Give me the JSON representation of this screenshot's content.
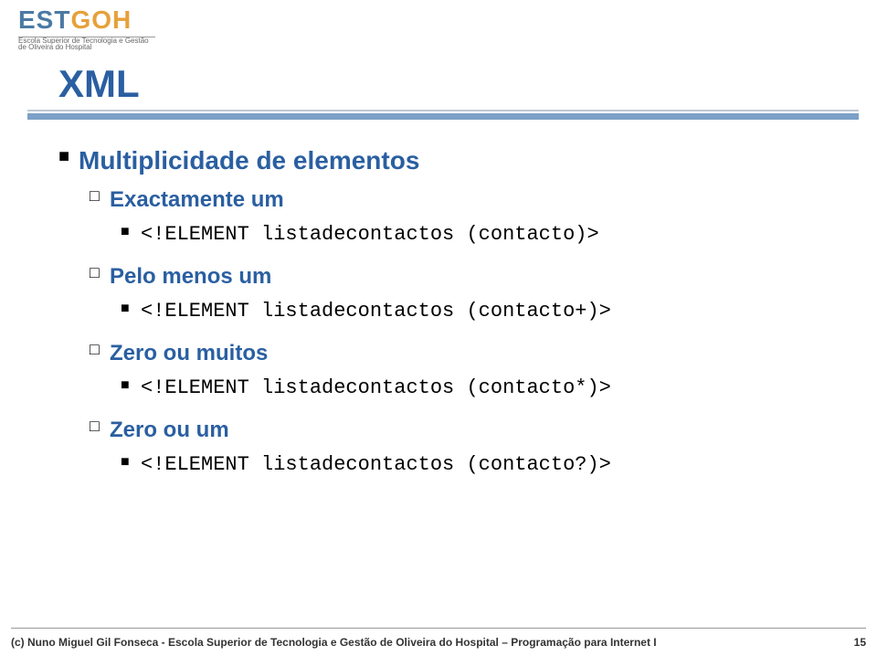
{
  "header": {
    "logo_left": "EST",
    "logo_right": "GOH",
    "logo_sub1": "Escola Superior de Tecnologia e Gestão",
    "logo_sub2": "de Oliveira do Hospital"
  },
  "title": "XML",
  "bullets": {
    "l1": "Multiplicidade de elementos",
    "s1": {
      "label": "Exactamente um",
      "code": "<!ELEMENT listadecontactos (contacto)>"
    },
    "s2": {
      "label": "Pelo menos um",
      "code": "<!ELEMENT listadecontactos (contacto+)>"
    },
    "s3": {
      "label": "Zero ou muitos",
      "code": "<!ELEMENT listadecontactos (contacto*)>"
    },
    "s4": {
      "label": "Zero ou um",
      "code": "<!ELEMENT listadecontactos (contacto?)>"
    }
  },
  "footer": {
    "left": "(c) Nuno Miguel Gil Fonseca  -  Escola Superior de Tecnologia e Gestão de Oliveira do Hospital  –  Programação para Internet I",
    "page": "15"
  },
  "glyphs": {
    "square_filled": "■",
    "square_hollow": "□"
  }
}
